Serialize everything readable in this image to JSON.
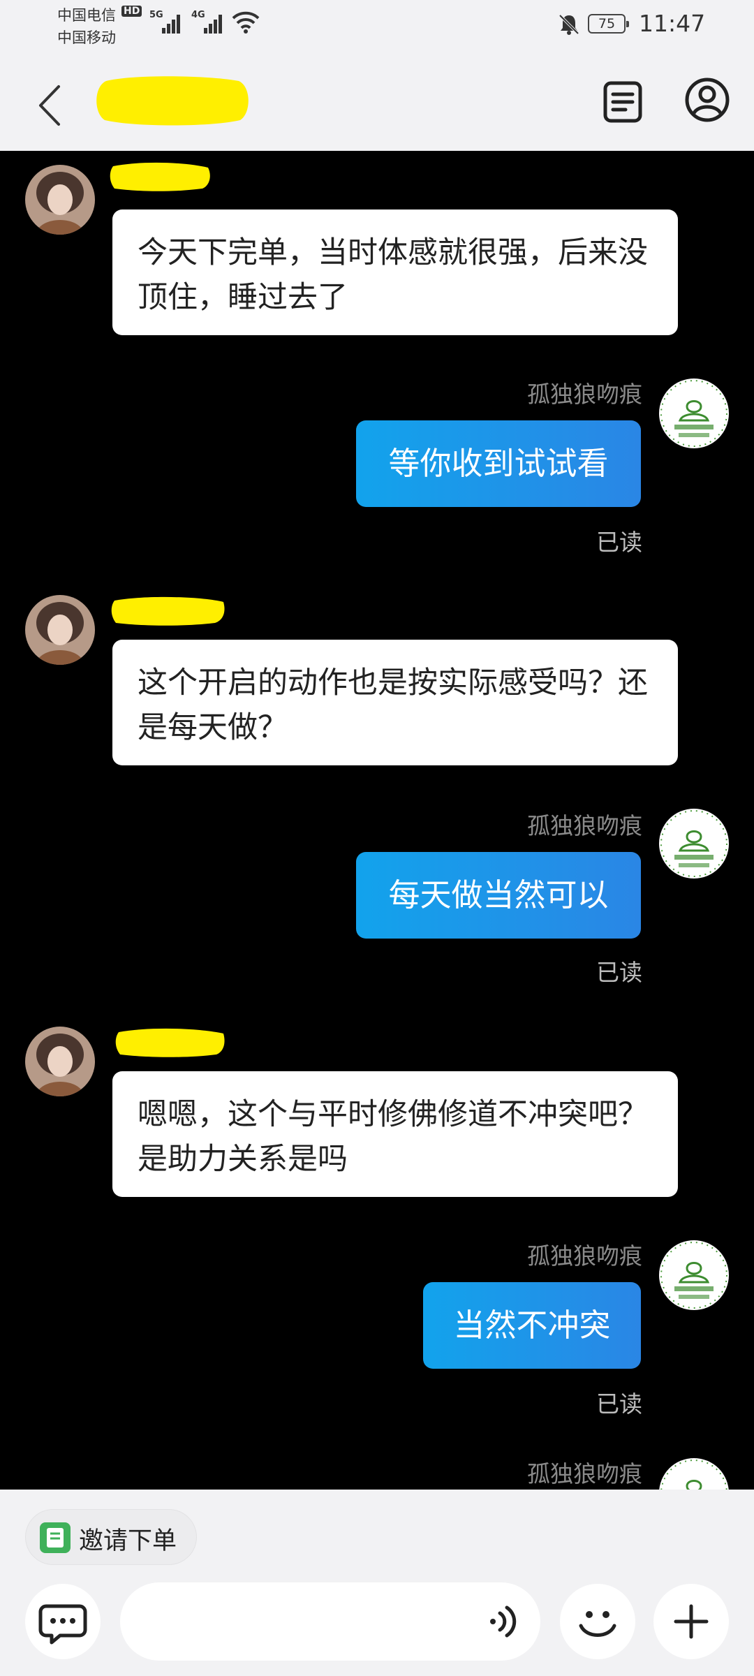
{
  "status_bar": {
    "carrier_1": "中国电信",
    "carrier_1_badge": "HD",
    "carrier_2": "中国移动",
    "network_1": "5G",
    "network_2": "4G",
    "battery": "75",
    "time": "11:47",
    "icons": [
      "signal-icon",
      "wifi-icon",
      "mute-bell-icon",
      "battery-icon"
    ]
  },
  "header": {
    "icons": [
      "back-chevron-icon",
      "order-list-icon",
      "profile-icon"
    ]
  },
  "messages": [
    {
      "direction": "in",
      "text": "今天下完单，当时体感就很强，后来没顶住，睡过去了"
    },
    {
      "direction": "out",
      "sender": "孤独狼吻痕",
      "text": "等你收到试试看",
      "status": "已读"
    },
    {
      "direction": "in",
      "text": "这个开启的动作也是按实际感受吗？还是每天做？"
    },
    {
      "direction": "out",
      "sender": "孤独狼吻痕",
      "text": "每天做当然可以",
      "status": "已读"
    },
    {
      "direction": "in",
      "text": "嗯嗯，这个与平时修佛修道不冲突吧？是助力关系是吗"
    },
    {
      "direction": "out",
      "sender": "孤独狼吻痕",
      "text": "当然不冲突",
      "status": "已读"
    },
    {
      "direction": "out",
      "sender": "孤独狼吻痕",
      "text": ""
    }
  ],
  "bottom_bar": {
    "invite_label": "邀请下单",
    "icons": [
      "invite-order-icon",
      "chat-bubble-icon",
      "voice-icon",
      "emoji-icon",
      "plus-icon"
    ]
  },
  "colors": {
    "bar_bg": "#f2f2f4",
    "chat_bg": "#000000",
    "outgoing_bubble": "#1a9ae8",
    "redaction": "#ffef00"
  }
}
